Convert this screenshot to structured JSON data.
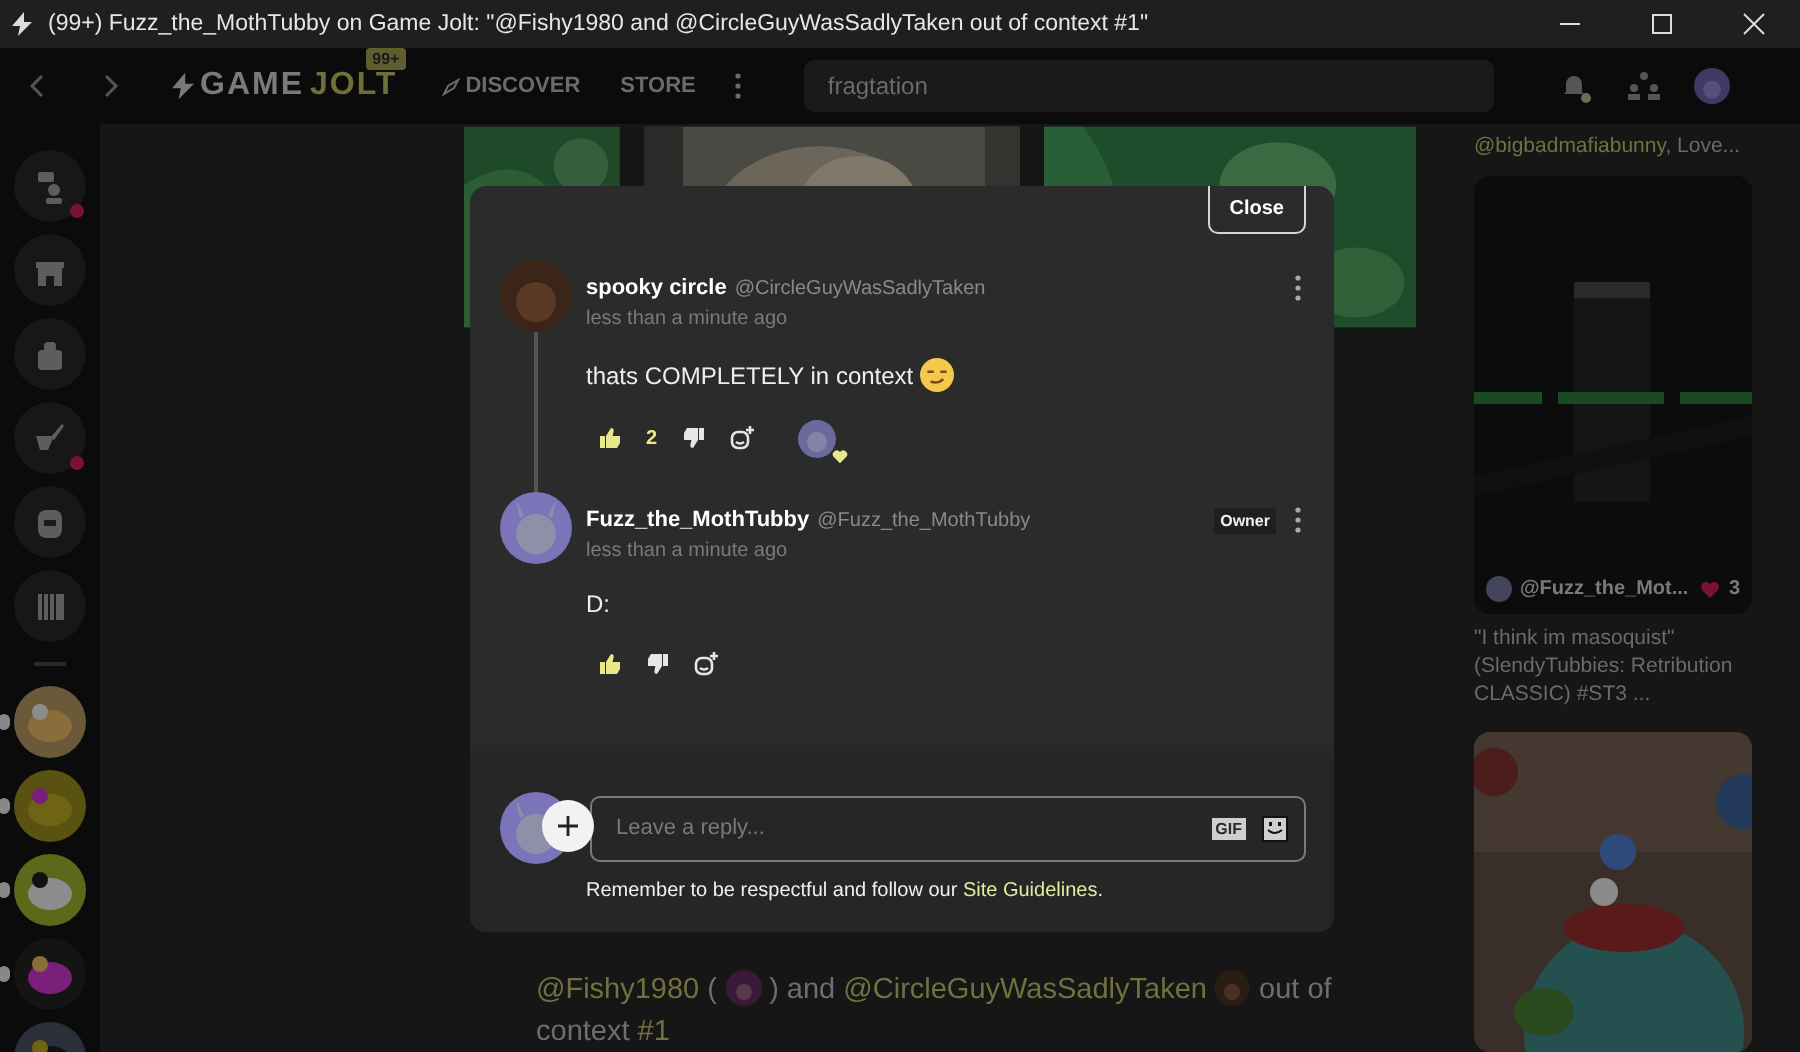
{
  "window": {
    "title": "(99+) Fuzz_the_MothTubby on Game Jolt: \"@Fishy1980 and @CircleGuyWasSadlyTaken out of context #1\""
  },
  "nav": {
    "logo_left": "GAME",
    "logo_right": "JOLT",
    "badge": "99+",
    "links": [
      {
        "label": "DISCOVER"
      },
      {
        "label": "STORE"
      }
    ],
    "search": {
      "value": "fragtation"
    },
    "notifications_unread": true
  },
  "sidebar": {
    "items": [
      {
        "unread": true
      },
      {
        "unread": false
      },
      {
        "unread": false
      },
      {
        "unread": true
      },
      {
        "unread": false
      },
      {
        "unread": false
      }
    ],
    "communities": [
      {
        "kind": "picture",
        "has_new": true
      },
      {
        "kind": "picture",
        "has_new": true
      },
      {
        "kind": "picture",
        "has_new": true
      },
      {
        "kind": "picture",
        "has_new": true
      },
      {
        "kind": "picture",
        "has_new": false
      }
    ]
  },
  "post": {
    "parts": [
      {
        "kind": "mention",
        "text": "@Fishy1980"
      },
      {
        "kind": "text",
        "text": "("
      },
      {
        "kind": "avatar"
      },
      {
        "kind": "text",
        "text": ") and"
      },
      {
        "kind": "mention",
        "text": "@CircleGuyWasSadlyTaken"
      },
      {
        "kind": "avatar"
      },
      {
        "kind": "text",
        "text": "out of context"
      },
      {
        "kind": "mention",
        "text": "#1"
      }
    ]
  },
  "side_feed": {
    "top_line": {
      "mention": "@bigbadmafiabunny",
      "rest": ", Love..."
    },
    "cards": [
      {
        "kind": "video",
        "user": "@Fuzz_the_Mot...",
        "likes": "3",
        "caption": "\"I think im masoquist\" (SlendyTubbies: Retribution CLASSIC) #ST3 ..."
      },
      {
        "kind": "picture"
      }
    ]
  },
  "modal": {
    "close": "Close",
    "comments": [
      {
        "name": "spooky circle",
        "handle": "@CircleGuyWasSadlyTaken",
        "time": "less than a minute ago",
        "text": "thats COMPLETELY in context",
        "emoji": true,
        "like_count": "2",
        "reacted": true,
        "threaded": true
      },
      {
        "name": "Fuzz_the_MothTubby",
        "handle": "@Fuzz_the_MothTubby",
        "badge": "Owner",
        "time": "less than a minute ago",
        "text": "D:",
        "emoji": false,
        "reacted": false,
        "threaded": false
      }
    ],
    "reply": {
      "placeholder": "Leave a reply...",
      "gif": "GIF",
      "note": "Remember to be respectful and follow our",
      "link": "Site Guidelines",
      "note_end": "."
    }
  }
}
